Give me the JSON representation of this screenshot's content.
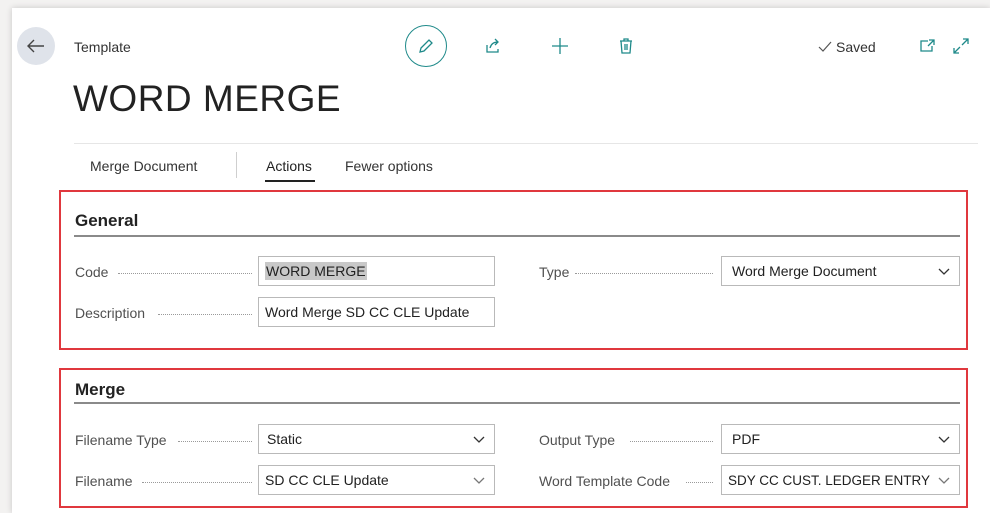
{
  "header": {
    "caption": "Template",
    "title": "WORD MERGE",
    "saved_label": "Saved"
  },
  "actions": {
    "merge_document": "Merge Document",
    "actions": "Actions",
    "fewer_options": "Fewer options"
  },
  "general": {
    "title": "General",
    "code_label": "Code",
    "code_value": "WORD MERGE",
    "description_label": "Description",
    "description_value": "Word Merge SD CC CLE Update",
    "type_label": "Type",
    "type_value": "Word Merge Document"
  },
  "merge": {
    "title": "Merge",
    "filename_type_label": "Filename Type",
    "filename_type_value": "Static",
    "filename_label": "Filename",
    "filename_value": "SD CC CLE Update",
    "output_type_label": "Output Type",
    "output_type_value": "PDF",
    "word_template_code_label": "Word Template Code",
    "word_template_code_value": "SDY CC CUST. LEDGER ENTRY"
  },
  "colors": {
    "accent": "#1f8a8a",
    "highlight_box": "#e0383e"
  },
  "icons": [
    "back-arrow-icon",
    "pencil-icon",
    "share-icon",
    "plus-icon",
    "trash-icon",
    "checkmark-icon",
    "open-new-window-icon",
    "expand-icon",
    "chevron-down-icon"
  ]
}
